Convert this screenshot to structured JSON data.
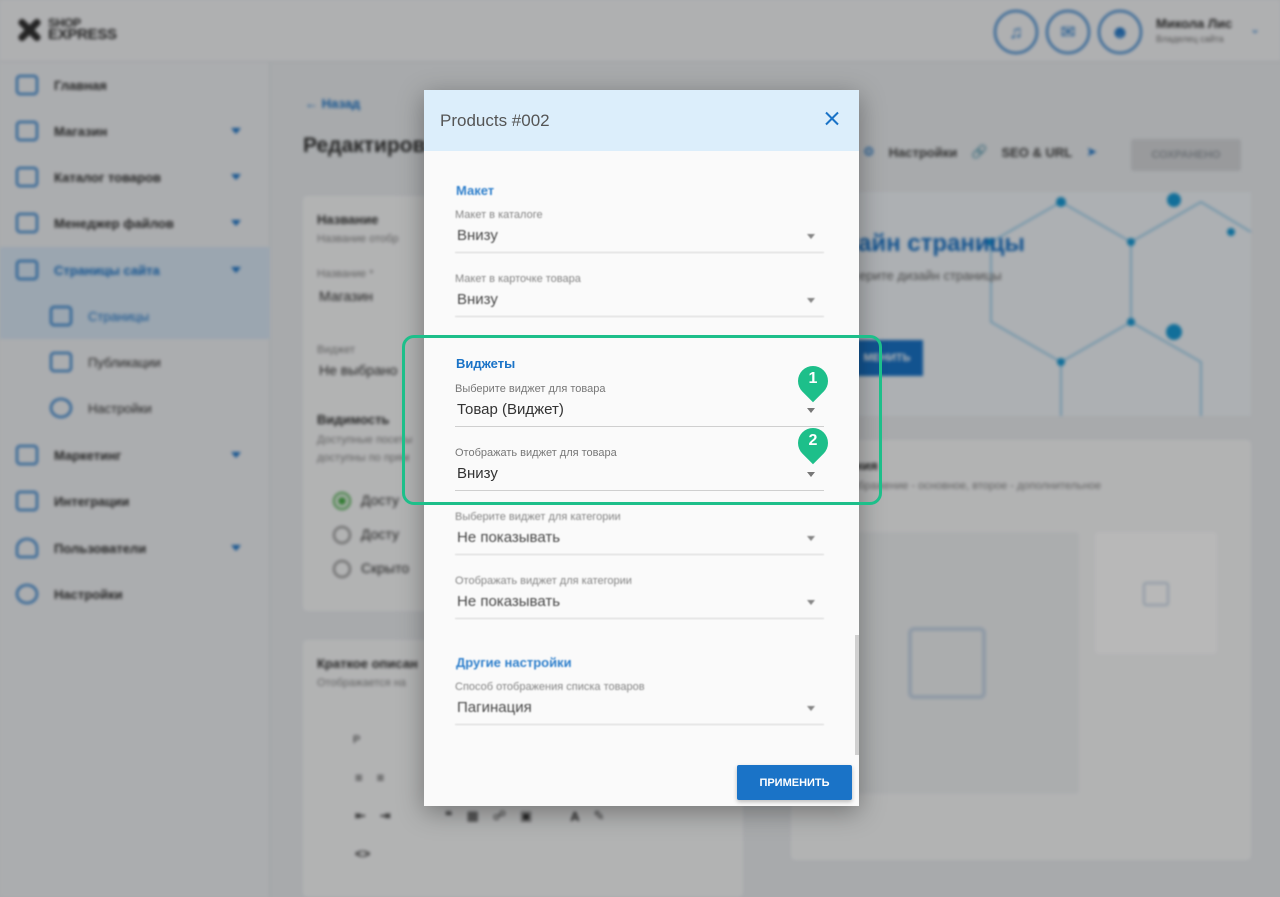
{
  "app": {
    "logo_line1": "SHOP",
    "logo_line2": "EXPRESS",
    "user_name": "Микола Лис",
    "user_role": "Владелец сайта"
  },
  "sidebar": {
    "items": [
      {
        "label": "Главная"
      },
      {
        "label": "Магазин"
      },
      {
        "label": "Каталог товаров"
      },
      {
        "label": "Менеджер файлов"
      },
      {
        "label": "Страницы сайта"
      },
      {
        "label": "Страницы"
      },
      {
        "label": "Публикации"
      },
      {
        "label": "Настройки"
      },
      {
        "label": "Маркетинг"
      },
      {
        "label": "Интеграции"
      },
      {
        "label": "Пользователи"
      },
      {
        "label": "Настройки"
      }
    ]
  },
  "main": {
    "back": "Назад",
    "title": "Редактиров",
    "toolbar": {
      "settings": "Настройки",
      "seo": "SEO & URL",
      "saved": "СОХРАНЕНО"
    },
    "name_card": {
      "title": "Название",
      "hint": "Название отобр",
      "field_label": "Название *",
      "field_value": "Магазин",
      "widget_label": "Виджет",
      "widget_value": "Не выбрано",
      "visibility_title": "Видимость",
      "visibility_hint1": "Доступные посеты",
      "visibility_hint2": "доступны по прям",
      "radio1": "Досту",
      "radio2": "Досту",
      "radio3": "Скрыто"
    },
    "desc_card": {
      "title": "Краткое описан",
      "hint": "Отображается на",
      "format": "P"
    },
    "design": {
      "title": "айн страницы",
      "sub": "ерите дизайн страницы",
      "btn": "МЕНИТЬ"
    },
    "image_card": {
      "title": "ения",
      "hint": "зображение - основное, второе - дополнительное"
    }
  },
  "modal": {
    "title": "Products #002",
    "sections": {
      "layout": "Макет",
      "widgets": "Виджеты",
      "other": "Другие настройки"
    },
    "fields": {
      "catalog_layout": {
        "label": "Макет в каталоге",
        "value": "Внизу"
      },
      "card_layout": {
        "label": "Макет в карточке товара",
        "value": "Внизу"
      },
      "product_widget": {
        "label": "Выберите виджет для товара",
        "value": "Товар (Виджет)"
      },
      "product_widget_pos": {
        "label": "Отображать виджет для товара",
        "value": "Внизу"
      },
      "category_widget": {
        "label": "Выберите виджет для категории",
        "value": "Не показывать"
      },
      "category_widget_pos": {
        "label": "Отображать виджет для категории",
        "value": "Не показывать"
      },
      "list_display": {
        "label": "Способ отображения списка товаров",
        "value": "Пагинация"
      }
    },
    "apply": "ПРИМЕНИТЬ"
  },
  "annotations": {
    "marker1": "1",
    "marker2": "2",
    "accent_color": "#1dbf8a"
  }
}
